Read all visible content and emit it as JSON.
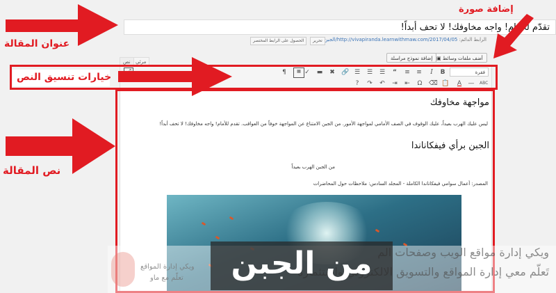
{
  "editor": {
    "post_title": "تقدّم للأمام! واجه مخاوفك! لا تحف أبداً!",
    "permalink_label": "الرابط الدائم:",
    "permalink_url": "http://vivapiranda.learnwithmaw.com/2017/04/05/الجبن/",
    "edit_label": "تحرير",
    "shortlink_label": "الحصول على الرابط المختصر",
    "add_media_label": "أضف ملفات وسائط",
    "add_form_label": "إضافة نموذج مراسلة",
    "tab_visual": "مرئي",
    "tab_text": "نص",
    "format_value": "فقرة",
    "content": {
      "heading1": "مواجهة مخاوفك",
      "para1": "ليس عليك الهرب بعيداً، عليك الوقوف في الصف الأمامي لمواجهة الأمور. من الجبن الامتناع عن المواجهة خوفاً من العواقب. تقدم للأمام! واجه مخاوفك! لا تحف أبداً!",
      "heading2": "الجبن برأي فيفكاناندا",
      "quote": "من الجبن الهرب بعيداً",
      "source": "المصدر: أعمال سوامي فيفكاناندا الكاملة - المجلد السادس: ملاحظات حول المحاضرات"
    }
  },
  "annotations": {
    "add_image": "إضافة صورة",
    "post_title": "عنوان المقالة",
    "format_options": "خيارات تنسيق النص",
    "post_body": "نص المقالة"
  },
  "watermark": {
    "big_text": "من الجبن",
    "line1": "ويكي إدارة مواقع الويب وصفحات الم",
    "line2": "تَعلّم معي إدارة المواقع والتسويق الالكتروني واستثماره",
    "logo_line1": "ويكي إدارة المواقع",
    "logo_line2": "تعلّم مع ماو"
  },
  "colors": {
    "annotation_red": "#e11b22",
    "link_blue": "#3b74b7"
  }
}
